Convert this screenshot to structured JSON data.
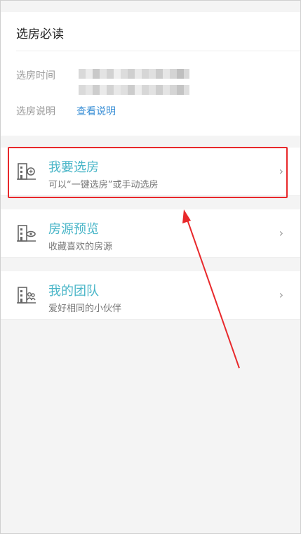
{
  "notice": {
    "title": "选房必读",
    "time_label": "选房时间",
    "desc_label": "选房说明",
    "desc_link": "查看说明"
  },
  "menu": [
    {
      "title": "我要选房",
      "subtitle": "可以“一键选房”或手动选房",
      "icon": "building-search-icon"
    },
    {
      "title": "房源预览",
      "subtitle": "收藏喜欢的房源",
      "icon": "building-eye-icon"
    },
    {
      "title": "我的团队",
      "subtitle": "爱好相同的小伙伴",
      "icon": "building-team-icon"
    }
  ],
  "colors": {
    "accent": "#4ab6c8",
    "link": "#3a8fd6",
    "annotation_red": "#e8282b"
  }
}
